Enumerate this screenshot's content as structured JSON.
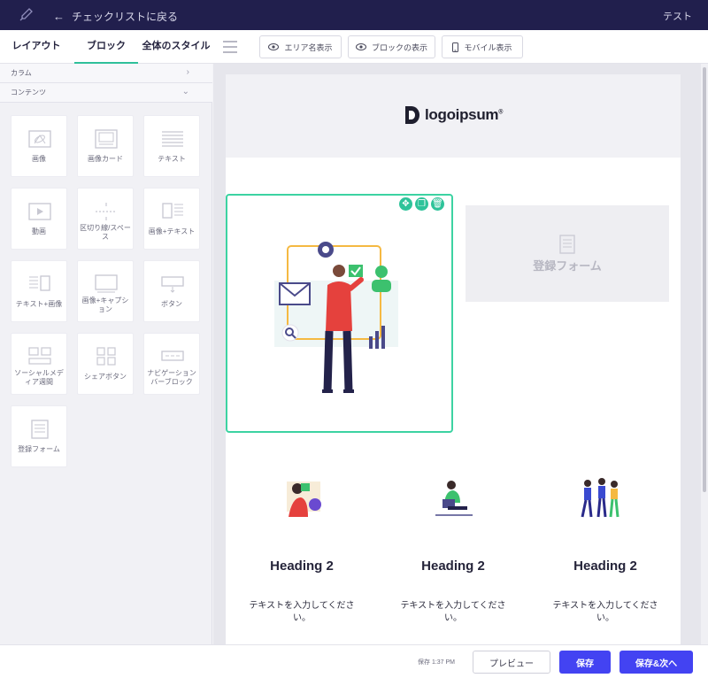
{
  "topbar": {
    "back_label": "チェックリストに戻る",
    "right_label": "テスト",
    "logo_icon": "rocket-icon"
  },
  "toolbar": {
    "tabs": [
      {
        "label": "レイアウト",
        "active": false
      },
      {
        "label": "ブロック",
        "active": true
      },
      {
        "label": "全体のスタイル",
        "active": false
      }
    ],
    "buttons": [
      {
        "label": "エリア名表示",
        "icon": "eye-icon"
      },
      {
        "label": "ブロックの表示",
        "icon": "eye-icon"
      },
      {
        "label": "モバイル表示",
        "icon": "mobile-icon"
      }
    ]
  },
  "sidebar": {
    "sections": [
      {
        "label": "カラム",
        "icon": "chevron-right-icon"
      },
      {
        "label": "コンテンツ",
        "icon": "chevron-down-icon"
      }
    ],
    "tiles": [
      {
        "label": "画像",
        "icon": "image-icon"
      },
      {
        "label": "画像カード",
        "icon": "image-card-icon"
      },
      {
        "label": "テキスト",
        "icon": "text-icon"
      },
      {
        "label": "動画",
        "icon": "video-icon"
      },
      {
        "label": "区切り線/スペース",
        "icon": "divider-icon"
      },
      {
        "label": "画像+テキスト",
        "icon": "image-text-icon"
      },
      {
        "label": "テキスト+画像",
        "icon": "text-image-icon"
      },
      {
        "label": "画像+キャプション",
        "icon": "image-caption-icon"
      },
      {
        "label": "ボタン",
        "icon": "button-icon"
      },
      {
        "label": "ソーシャルメディア週間",
        "icon": "social-icon"
      },
      {
        "label": "シェアボタン",
        "icon": "share-icon"
      },
      {
        "label": "ナビゲーションバーブロック",
        "icon": "navbar-icon"
      },
      {
        "label": "登録フォーム",
        "icon": "form-icon"
      }
    ]
  },
  "canvas": {
    "brand_name": "logoipsum",
    "brand_mark": "®",
    "form_placeholder": "登録フォーム",
    "columns": [
      {
        "heading": "Heading 2",
        "text": "テキストを入力してください。"
      },
      {
        "heading": "Heading 2",
        "text": "テキストを入力してください。"
      },
      {
        "heading": "Heading 2",
        "text": "テキストを入力してください。"
      }
    ],
    "block_actions": [
      "move-icon",
      "copy-icon",
      "trash-icon"
    ]
  },
  "footer": {
    "saved_label": "保存 1:37 PM",
    "preview_label": "プレビュー",
    "save_label": "保存",
    "save_next_label": "保存&次へ"
  },
  "colors": {
    "topbar": "#211f4d",
    "accent": "#2fc09a",
    "primary": "#4343f2"
  }
}
